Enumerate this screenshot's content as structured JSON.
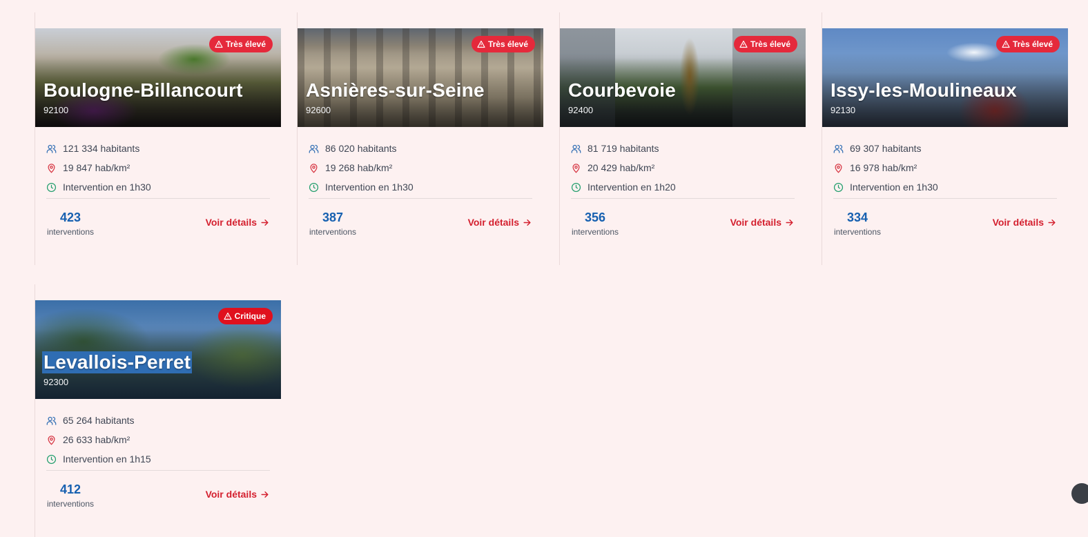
{
  "labels": {
    "interventions": "interventions",
    "details": "Voir détails"
  },
  "colors": {
    "badge_high": "#e5293b",
    "badge_critical": "#e0101e",
    "count": "#1660b0",
    "link": "#d41f2e",
    "people_icon": "#2f6db3",
    "pin_icon": "#d63340",
    "clock_icon": "#1f9d6b"
  },
  "cities": [
    {
      "name": "Boulogne-Billancourt",
      "zip": "92100",
      "badge": "Très élevé",
      "population": "121 334 habitants",
      "density": "19 847 hab/km²",
      "intervention": "Intervention en 1h30",
      "count": "423"
    },
    {
      "name": "Asnières-sur-Seine",
      "zip": "92600",
      "badge": "Très élevé",
      "population": "86 020 habitants",
      "density": "19 268 hab/km²",
      "intervention": "Intervention en 1h30",
      "count": "387"
    },
    {
      "name": "Courbevoie",
      "zip": "92400",
      "badge": "Très élevé",
      "population": "81 719 habitants",
      "density": "20 429 hab/km²",
      "intervention": "Intervention en 1h20",
      "count": "356"
    },
    {
      "name": "Issy-les-Moulineaux",
      "zip": "92130",
      "badge": "Très élevé",
      "population": "69 307 habitants",
      "density": "16 978 hab/km²",
      "intervention": "Intervention en 1h30",
      "count": "334"
    },
    {
      "name": "Levallois-Perret",
      "zip": "92300",
      "badge": "Critique",
      "population": "65 264 habitants",
      "density": "26 633 hab/km²",
      "intervention": "Intervention en 1h15",
      "count": "412"
    }
  ]
}
